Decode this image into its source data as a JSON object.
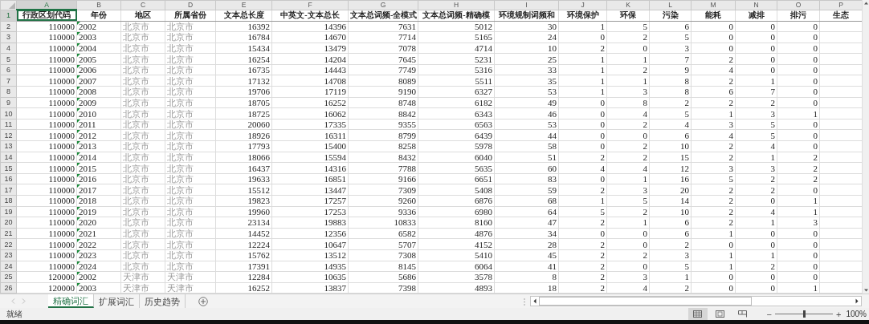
{
  "column_letters": [
    "A",
    "B",
    "C",
    "D",
    "E",
    "F",
    "G",
    "H",
    "I",
    "J",
    "K",
    "L",
    "M",
    "N",
    "O",
    "P"
  ],
  "header_row_number": "1",
  "columns": [
    {
      "header": "行政区划代码",
      "kind": "number",
      "selected": true
    },
    {
      "header": "年份",
      "kind": "flagged_text",
      "selected": false
    },
    {
      "header": "地区",
      "kind": "muted_text",
      "selected": false
    },
    {
      "header": "所属省份",
      "kind": "muted_text",
      "selected": false
    },
    {
      "header": "文本总长度",
      "kind": "number",
      "selected": false
    },
    {
      "header": "中英文-文本总长",
      "kind": "number",
      "selected": false
    },
    {
      "header": "文本总词频-全模式",
      "kind": "number",
      "selected": false
    },
    {
      "header": "文本总词频-精确模",
      "kind": "number",
      "selected": false
    },
    {
      "header": "环境规制词频和",
      "kind": "number",
      "selected": false
    },
    {
      "header": "环境保护",
      "kind": "number",
      "selected": false
    },
    {
      "header": "环保",
      "kind": "number",
      "selected": false
    },
    {
      "header": "污染",
      "kind": "number",
      "selected": false
    },
    {
      "header": "能耗",
      "kind": "number",
      "selected": false
    },
    {
      "header": "减排",
      "kind": "number",
      "selected": false
    },
    {
      "header": "排污",
      "kind": "number",
      "selected": false
    },
    {
      "header": "生态",
      "kind": "number",
      "selected": false
    }
  ],
  "rows": [
    {
      "number": "2",
      "cells": [
        "110000",
        "2002",
        "北京市",
        "北京市",
        "16392",
        "14396",
        "7631",
        "5012",
        "30",
        "1",
        "5",
        "6",
        "0",
        "0",
        "0"
      ]
    },
    {
      "number": "3",
      "cells": [
        "110000",
        "2003",
        "北京市",
        "北京市",
        "16784",
        "14670",
        "7714",
        "5165",
        "24",
        "0",
        "2",
        "5",
        "0",
        "0",
        "0"
      ]
    },
    {
      "number": "4",
      "cells": [
        "110000",
        "2004",
        "北京市",
        "北京市",
        "15434",
        "13479",
        "7078",
        "4714",
        "10",
        "2",
        "0",
        "3",
        "0",
        "0",
        "0"
      ]
    },
    {
      "number": "5",
      "cells": [
        "110000",
        "2005",
        "北京市",
        "北京市",
        "16254",
        "14204",
        "7645",
        "5231",
        "25",
        "1",
        "1",
        "7",
        "2",
        "0",
        "0"
      ]
    },
    {
      "number": "6",
      "cells": [
        "110000",
        "2006",
        "北京市",
        "北京市",
        "16735",
        "14443",
        "7749",
        "5316",
        "33",
        "1",
        "2",
        "9",
        "4",
        "0",
        "0"
      ]
    },
    {
      "number": "7",
      "cells": [
        "110000",
        "2007",
        "北京市",
        "北京市",
        "17132",
        "14708",
        "8089",
        "5511",
        "35",
        "1",
        "1",
        "8",
        "2",
        "1",
        "0"
      ]
    },
    {
      "number": "8",
      "cells": [
        "110000",
        "2008",
        "北京市",
        "北京市",
        "19706",
        "17119",
        "9190",
        "6327",
        "53",
        "1",
        "3",
        "8",
        "6",
        "7",
        "0"
      ]
    },
    {
      "number": "9",
      "cells": [
        "110000",
        "2009",
        "北京市",
        "北京市",
        "18705",
        "16252",
        "8748",
        "6182",
        "49",
        "0",
        "8",
        "2",
        "2",
        "2",
        "0"
      ]
    },
    {
      "number": "10",
      "cells": [
        "110000",
        "2010",
        "北京市",
        "北京市",
        "18725",
        "16062",
        "8842",
        "6343",
        "46",
        "0",
        "4",
        "5",
        "1",
        "3",
        "1"
      ]
    },
    {
      "number": "11",
      "cells": [
        "110000",
        "2011",
        "北京市",
        "北京市",
        "20060",
        "17335",
        "9355",
        "6563",
        "53",
        "0",
        "2",
        "4",
        "3",
        "5",
        "0"
      ]
    },
    {
      "number": "12",
      "cells": [
        "110000",
        "2012",
        "北京市",
        "北京市",
        "18926",
        "16311",
        "8799",
        "6439",
        "44",
        "0",
        "0",
        "6",
        "4",
        "5",
        "0"
      ]
    },
    {
      "number": "13",
      "cells": [
        "110000",
        "2013",
        "北京市",
        "北京市",
        "17793",
        "15400",
        "8258",
        "5978",
        "58",
        "0",
        "2",
        "10",
        "2",
        "4",
        "0"
      ]
    },
    {
      "number": "14",
      "cells": [
        "110000",
        "2014",
        "北京市",
        "北京市",
        "18066",
        "15594",
        "8432",
        "6040",
        "51",
        "2",
        "2",
        "15",
        "2",
        "1",
        "2"
      ]
    },
    {
      "number": "15",
      "cells": [
        "110000",
        "2015",
        "北京市",
        "北京市",
        "16437",
        "14316",
        "7788",
        "5635",
        "60",
        "4",
        "4",
        "12",
        "3",
        "3",
        "2"
      ]
    },
    {
      "number": "16",
      "cells": [
        "110000",
        "2016",
        "北京市",
        "北京市",
        "19633",
        "16851",
        "9166",
        "6651",
        "83",
        "0",
        "1",
        "16",
        "5",
        "2",
        "2"
      ]
    },
    {
      "number": "17",
      "cells": [
        "110000",
        "2017",
        "北京市",
        "北京市",
        "15512",
        "13447",
        "7309",
        "5408",
        "59",
        "2",
        "3",
        "20",
        "2",
        "2",
        "0"
      ]
    },
    {
      "number": "18",
      "cells": [
        "110000",
        "2018",
        "北京市",
        "北京市",
        "19823",
        "17257",
        "9260",
        "6876",
        "68",
        "1",
        "5",
        "14",
        "2",
        "0",
        "1"
      ]
    },
    {
      "number": "19",
      "cells": [
        "110000",
        "2019",
        "北京市",
        "北京市",
        "19960",
        "17253",
        "9336",
        "6980",
        "64",
        "5",
        "2",
        "10",
        "2",
        "4",
        "1"
      ]
    },
    {
      "number": "20",
      "cells": [
        "110000",
        "2020",
        "北京市",
        "北京市",
        "23134",
        "19883",
        "10833",
        "8160",
        "47",
        "2",
        "1",
        "6",
        "2",
        "1",
        "3"
      ]
    },
    {
      "number": "21",
      "cells": [
        "110000",
        "2021",
        "北京市",
        "北京市",
        "14452",
        "12356",
        "6582",
        "4876",
        "34",
        "0",
        "0",
        "6",
        "1",
        "0",
        "0"
      ]
    },
    {
      "number": "22",
      "cells": [
        "110000",
        "2022",
        "北京市",
        "北京市",
        "12224",
        "10647",
        "5707",
        "4152",
        "28",
        "2",
        "0",
        "2",
        "0",
        "0",
        "0"
      ]
    },
    {
      "number": "23",
      "cells": [
        "110000",
        "2023",
        "北京市",
        "北京市",
        "15762",
        "13512",
        "7308",
        "5410",
        "45",
        "2",
        "2",
        "3",
        "1",
        "1",
        "0"
      ]
    },
    {
      "number": "24",
      "cells": [
        "110000",
        "2024",
        "北京市",
        "北京市",
        "17391",
        "14935",
        "8145",
        "6064",
        "41",
        "2",
        "0",
        "5",
        "1",
        "2",
        "0"
      ]
    },
    {
      "number": "25",
      "cells": [
        "120000",
        "2002",
        "天津市",
        "天津市",
        "12284",
        "10635",
        "5686",
        "3578",
        "8",
        "2",
        "3",
        "1",
        "0",
        "0",
        "0"
      ]
    },
    {
      "number": "26",
      "cells": [
        "120000",
        "2003",
        "天津市",
        "天津市",
        "16252",
        "13837",
        "7398",
        "4893",
        "18",
        "2",
        "4",
        "2",
        "0",
        "0",
        "1"
      ]
    }
  ],
  "sheet_tabs": [
    {
      "label": "精确词汇",
      "selected": true
    },
    {
      "label": "扩展词汇",
      "selected": false
    },
    {
      "label": "历史趋势",
      "selected": false
    }
  ],
  "status_bar": {
    "text": "就绪",
    "views": [
      {
        "kind": "normal",
        "selected": true
      },
      {
        "kind": "page_layout",
        "selected": false
      },
      {
        "kind": "page_break",
        "selected": false
      }
    ],
    "zoom_out": "−",
    "zoom_in": "+",
    "zoom_slider": {
      "level": 0.5
    },
    "zoom": "100%"
  }
}
